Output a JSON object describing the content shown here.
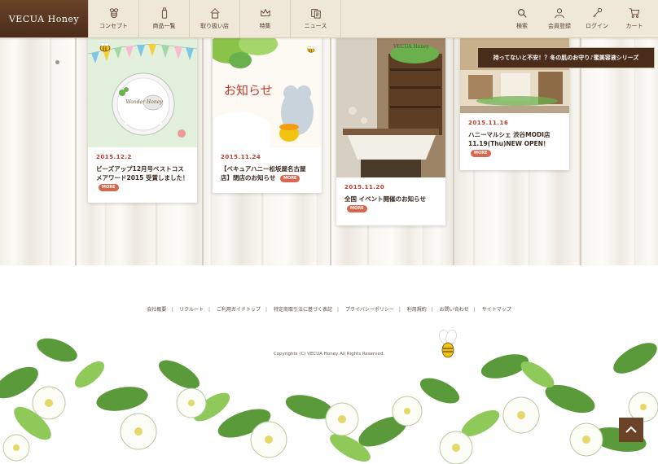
{
  "header": {
    "logo": "VECUA Honey",
    "nav_left": [
      {
        "label": "コンセプト",
        "icon": "bee-icon"
      },
      {
        "label": "商品一覧",
        "icon": "bottle-icon"
      },
      {
        "label": "取り扱い店",
        "icon": "shop-icon"
      },
      {
        "label": "特集",
        "icon": "crown-icon"
      },
      {
        "label": "ニュース",
        "icon": "document-icon"
      }
    ],
    "nav_right": [
      {
        "label": "検索",
        "icon": "search-icon"
      },
      {
        "label": "会員登録",
        "icon": "user-icon"
      },
      {
        "label": "ログイン",
        "icon": "key-icon"
      },
      {
        "label": "カート",
        "icon": "cart-icon"
      }
    ]
  },
  "banner": "持ってないと不安！？冬の肌のお守り♪蜜美容液シリーズ",
  "news": [
    {
      "date": "2015.12.2",
      "title": "ビーズアップ12月号ベストコスメアワード2015 受賞しました！",
      "more": "MORE",
      "image_text": "Wonder Honey"
    },
    {
      "date": "2015.11.24",
      "title": "【ベキュアハニー松坂屋名古屋店】閉店のお知らせ",
      "more": "MORE",
      "image_text": "お知らせ"
    },
    {
      "date": "2015.11.20",
      "title": "全国 イベント開催のお知らせ",
      "more": "MORE",
      "image_text": "VECUA Honey"
    },
    {
      "date": "2015.11.16",
      "title": "ハニーマルシェ 渋谷MODI店 11.19(Thu)NEW OPEN！",
      "more": "MORE"
    }
  ],
  "footer": {
    "links": [
      "会社概要",
      "リクルート",
      "ご利用ガイドトップ",
      "特定商取引法に基づく表記",
      "プライバシーポリシー",
      "利用規約",
      "お問い合わせ",
      "サイトマップ"
    ],
    "copyright": "Copyrights (C) VECUA Honey All Rights Reserved."
  },
  "colors": {
    "brand_brown": "#4a2c1a",
    "accent_red": "#c0392b",
    "more_badge": "#d9664d"
  }
}
